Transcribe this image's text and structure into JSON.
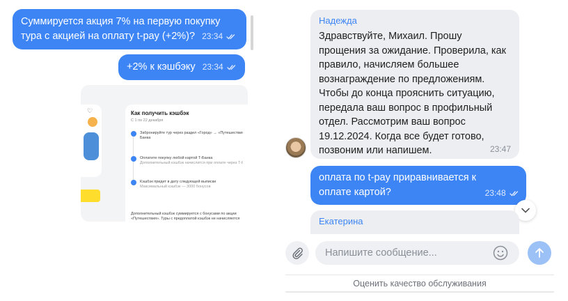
{
  "left_chat": {
    "messages": [
      {
        "text": "Суммируется акция 7% на первую покупку тура с акцией на оплату t-pay (+2%)?",
        "time": "23:34"
      },
      {
        "text": "+2% к кэшбэку",
        "time": "23:34"
      }
    ],
    "attachment": {
      "title": "Как получить кэшбэк",
      "subtitle": "С 1 по 22 декабря",
      "steps": [
        {
          "line1": "Забронируйте тур через раздел «Город» → «Путешествия» в приложении Т-",
          "line2": "Банка"
        },
        {
          "line1": "Оплатите покупку любой картой Т-Банка",
          "line2": "Дополнительный кэшбэк начислится при оплате через T-Pay"
        },
        {
          "line1": "Кэшбэк придет в дату следующей выписки",
          "line2": "Максимальный кэшбэк — 3000 бонусов"
        }
      ],
      "footer": "Дополнительный кэшбэк суммируется с бонусами по акции «Путешествия». Туры с предоплатой кэшбэк не начисляются"
    }
  },
  "right_chat": {
    "messages": [
      {
        "sender": "Надежда",
        "text": "Здравствуйте, Михаил. Прошу прощения за ожидание. Проверила, как правило, начисляем большее вознаграждение по предложениям. Чтобы до конца прояснить ситуацию, передала ваш вопрос в профильный отдел. Рассмотрим ваш вопрос 19.12.2024. Когда все будет готово, позвоним или напишем.",
        "time": "23:47"
      },
      {
        "text": "оплата по t-pay приравнивается к оплате картой?",
        "time": "23:48"
      },
      {
        "sender": "Екатерина"
      }
    ],
    "composer": {
      "placeholder": "Напишите сообщение..."
    },
    "rate_label": "Оценить качество обслуживания"
  },
  "colors": {
    "accent": "#3d85f5",
    "incoming_bubble": "#eceef1",
    "sender_name": "#3d85f5"
  },
  "icons": [
    "read-checkmarks-icon",
    "chevron-down-icon",
    "paperclip-icon",
    "smile-icon",
    "arrow-up-icon",
    "heart-icon"
  ]
}
